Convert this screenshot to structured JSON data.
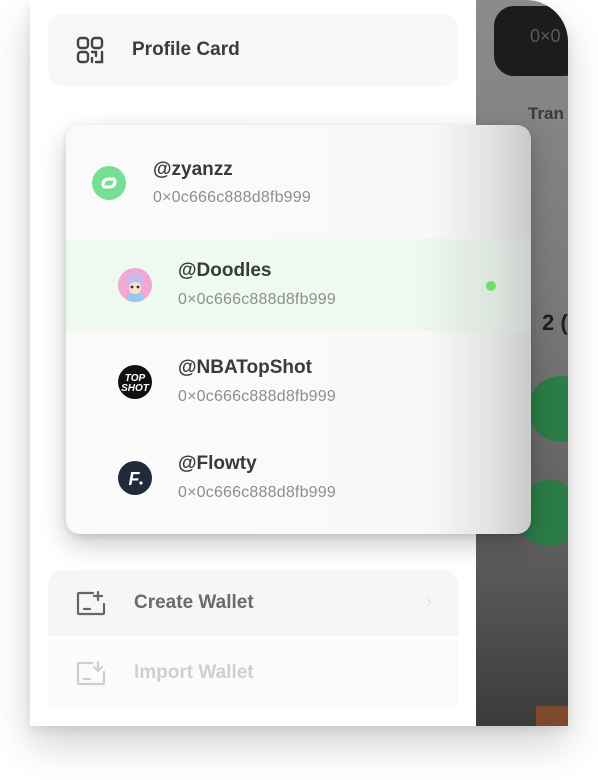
{
  "drawer": {
    "profile_card_label": "Profile Card",
    "create_wallet_label": "Create Wallet",
    "import_wallet_label": "Import Wallet"
  },
  "background_app": {
    "top_text": "0×0",
    "tran_text": "Tran",
    "count_text": "2 (",
    "circle_color": "#2b7c46"
  },
  "accounts": [
    {
      "handle": "@zyanzz",
      "address": "0×0c666c888d8fb999",
      "avatar": "flow-logo-icon",
      "selected": false
    },
    {
      "handle": "@Doodles",
      "address": "0×0c666c888d8fb999",
      "avatar": "doodles-avatar-icon",
      "selected": true
    },
    {
      "handle": "@NBATopShot",
      "address": "0×0c666c888d8fb999",
      "avatar": "topshot-logo-icon",
      "selected": false
    },
    {
      "handle": "@Flowty",
      "address": "0×0c666c888d8fb999",
      "avatar": "flowty-logo-icon",
      "selected": false
    }
  ],
  "colors": {
    "selected_bg": "#eefaf1",
    "active_dot": "#6fe067",
    "flow_green": "#76df94"
  }
}
